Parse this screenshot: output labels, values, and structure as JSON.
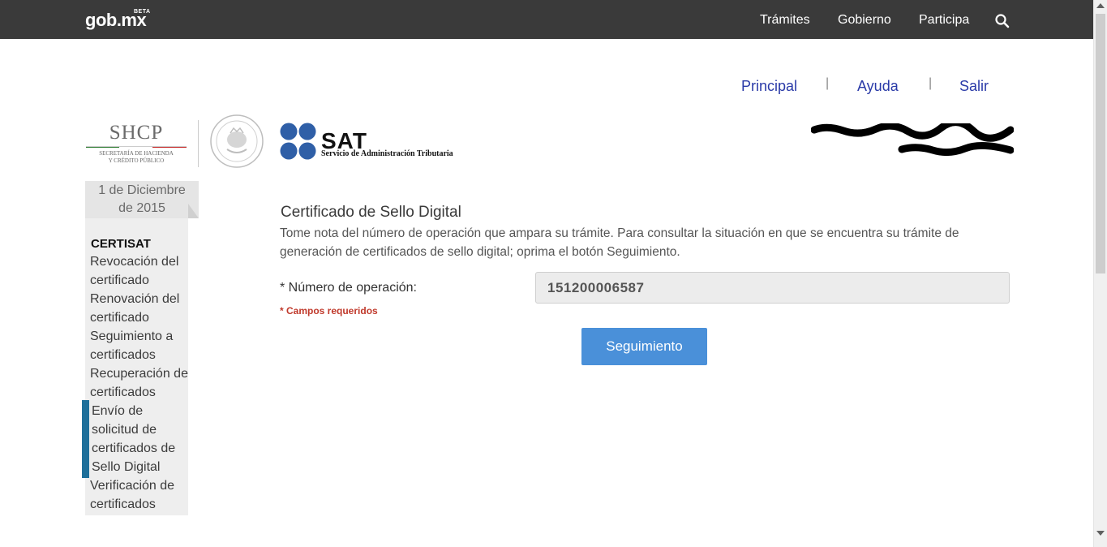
{
  "header": {
    "brand": "gob.mx",
    "beta": "BETA",
    "nav": [
      "Trámites",
      "Gobierno",
      "Participa"
    ],
    "search_icon": "search-icon"
  },
  "utility_links": [
    "Principal",
    "Ayuda",
    "Salir"
  ],
  "logos": {
    "shcp": "SHCP",
    "shcp_sub_1": "Secretaría de Hacienda",
    "shcp_sub_2": "y Crédito Público",
    "sat": "SAT",
    "sat_sub": "Servicio de Administración Tributaria"
  },
  "sidebar": {
    "date_line1": "1 de Diciembre",
    "date_line2": "de 2015",
    "section": "CERTISAT",
    "items": [
      "Revocación del certificado",
      "Renovación del certificado",
      "Seguimiento a certificados",
      "Recuperación de certificados",
      "Envío de solicitud de certificados de Sello Digital",
      "Verificación de certificados"
    ],
    "active_index": 4
  },
  "main": {
    "title": "Certificado de Sello Digital",
    "description": "Tome nota del número de operación que ampara su trámite. Para consultar la situación en que se encuentra su trámite de generación de certificados de sello digital; oprima el botón Seguimiento.",
    "field_label": "* Número de operación:",
    "field_value": "151200006587",
    "required_note": "* Campos requeridos",
    "button": "Seguimiento"
  },
  "colors": {
    "topbar": "#3a3a3a",
    "link": "#2a3aa8",
    "button": "#4a90d9",
    "active_bar": "#1e6f9a",
    "required": "#c0392b"
  }
}
